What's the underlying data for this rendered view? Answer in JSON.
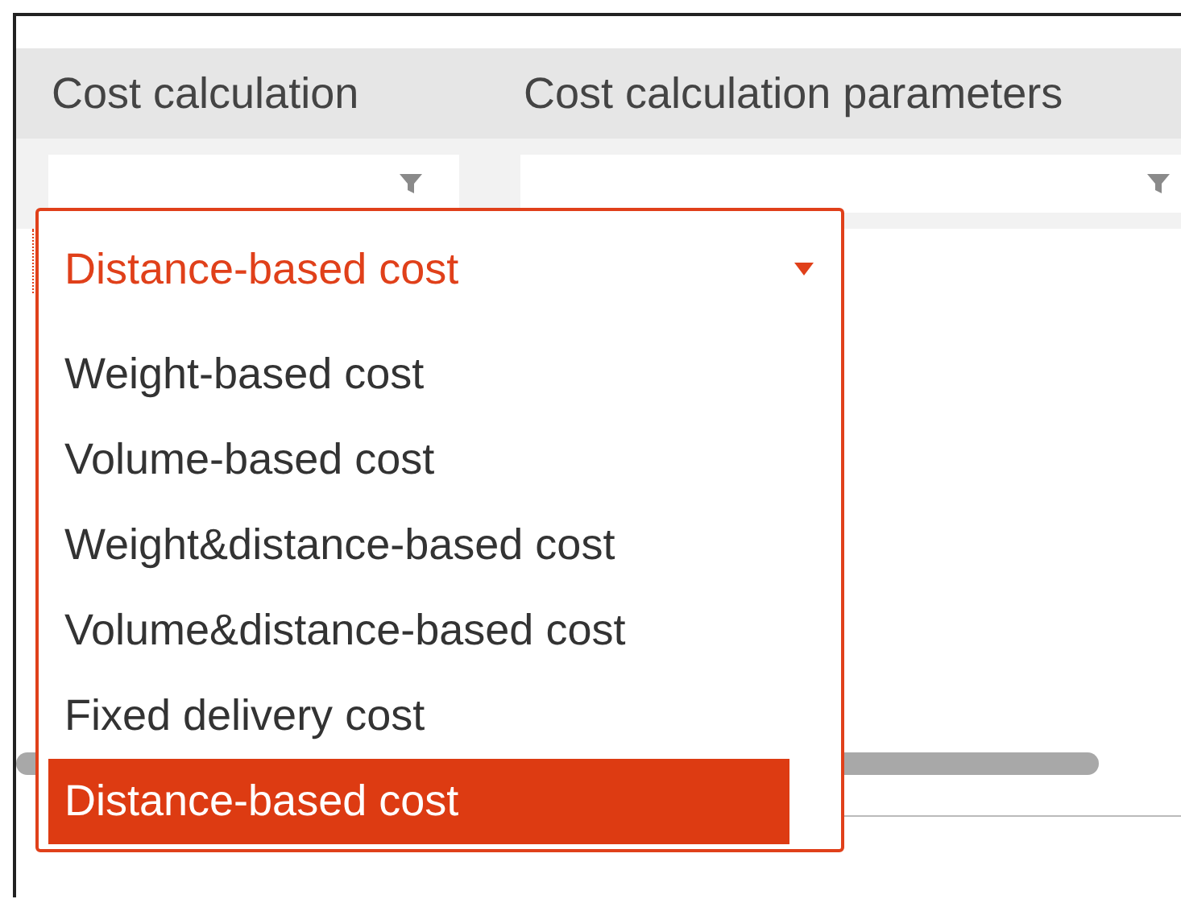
{
  "columns": [
    {
      "label": "Cost calculation"
    },
    {
      "label": "Cost calculation parameters"
    }
  ],
  "dropdown": {
    "value": "Distance-based cost",
    "expanded": true,
    "options": [
      {
        "label": "Weight-based cost",
        "selected": false
      },
      {
        "label": "Volume-based cost",
        "selected": false
      },
      {
        "label": "Weight&distance-based cost",
        "selected": false
      },
      {
        "label": "Volume&distance-based cost",
        "selected": false
      },
      {
        "label": "Fixed delivery cost",
        "selected": false
      },
      {
        "label": "Distance-based cost",
        "selected": true
      }
    ]
  }
}
